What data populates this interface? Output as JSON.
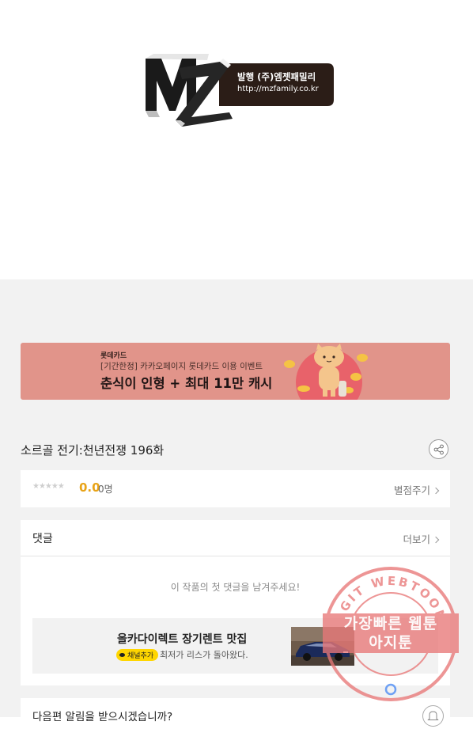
{
  "publisher": {
    "name_line": "발행 (주)엠젯패밀리",
    "url_line": "http://mzfamily.co.kr"
  },
  "banner": {
    "brand": "롯데카드",
    "sub": "[기간한정] 카카오페이지 롯데카드 이용 이벤트",
    "headline": "춘식이 인형 + 최대 11만 캐시"
  },
  "episode": {
    "title": "소르골 전기:천년전쟁 196화"
  },
  "rating": {
    "stars": "★★★★★",
    "score": "0.0",
    "raters": "0명",
    "rate_link": "별점주기"
  },
  "comments": {
    "title": "댓글",
    "more": "더보기",
    "empty": "이 작품의 첫 댓글을 남겨주세요!"
  },
  "ad": {
    "title": "올카다이렉트 장기렌트 맛집",
    "badge": "채널추가",
    "text": "최저가 리스가 돌아왔다."
  },
  "notify": {
    "text": "다음편 알림을 받으시겠습니까?"
  },
  "watermark": {
    "ring_text": "AGIT WEBTOON",
    "line1": "가장빠른 웹툰",
    "line2": "아지툰"
  },
  "colors": {
    "banner_bg": "#e1948a",
    "score": "#e8a317",
    "page_bg": "#f2f2f2",
    "watermark": "#e87878"
  }
}
